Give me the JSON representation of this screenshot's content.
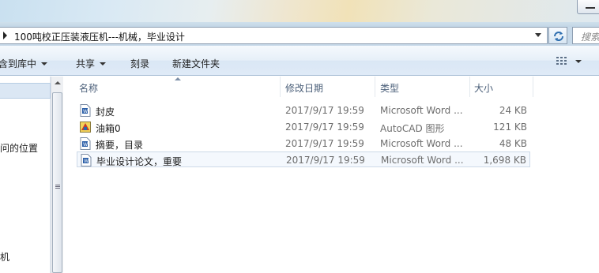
{
  "address": {
    "path": "100吨校正压装液压机---机械，毕业设计"
  },
  "search": {
    "placeholder": "搜索"
  },
  "toolbar": {
    "include_library": "包含到库中",
    "share": "共享",
    "burn": "刻录",
    "new_folder": "新建文件夹"
  },
  "nav": {
    "item_recent": "最近访问的位置",
    "item_bottom": "计算机"
  },
  "columns": {
    "name": "名称",
    "date": "修改日期",
    "type": "类型",
    "size": "大小"
  },
  "files": [
    {
      "name": "封皮",
      "date": "2017/9/17 19:59",
      "type": "Microsoft Word ...",
      "size": "24 KB",
      "icon": "word-doc-icon"
    },
    {
      "name": "油箱0",
      "date": "2017/9/17 19:59",
      "type": "AutoCAD 图形",
      "size": "121 KB",
      "icon": "autocad-dwg-icon"
    },
    {
      "name": "摘要，目录",
      "date": "2017/9/17 19:59",
      "type": "Microsoft Word ...",
      "size": "48 KB",
      "icon": "word-doc-icon"
    },
    {
      "name": "毕业设计论文，重要",
      "date": "2017/9/17 19:59",
      "type": "Microsoft Word ...",
      "size": "1,698 KB",
      "icon": "word-doc-icon"
    }
  ],
  "colors": {
    "selection_bg": "#f4f8fd",
    "selection_border": "#cdd9e8",
    "header_text": "#4c607a"
  }
}
